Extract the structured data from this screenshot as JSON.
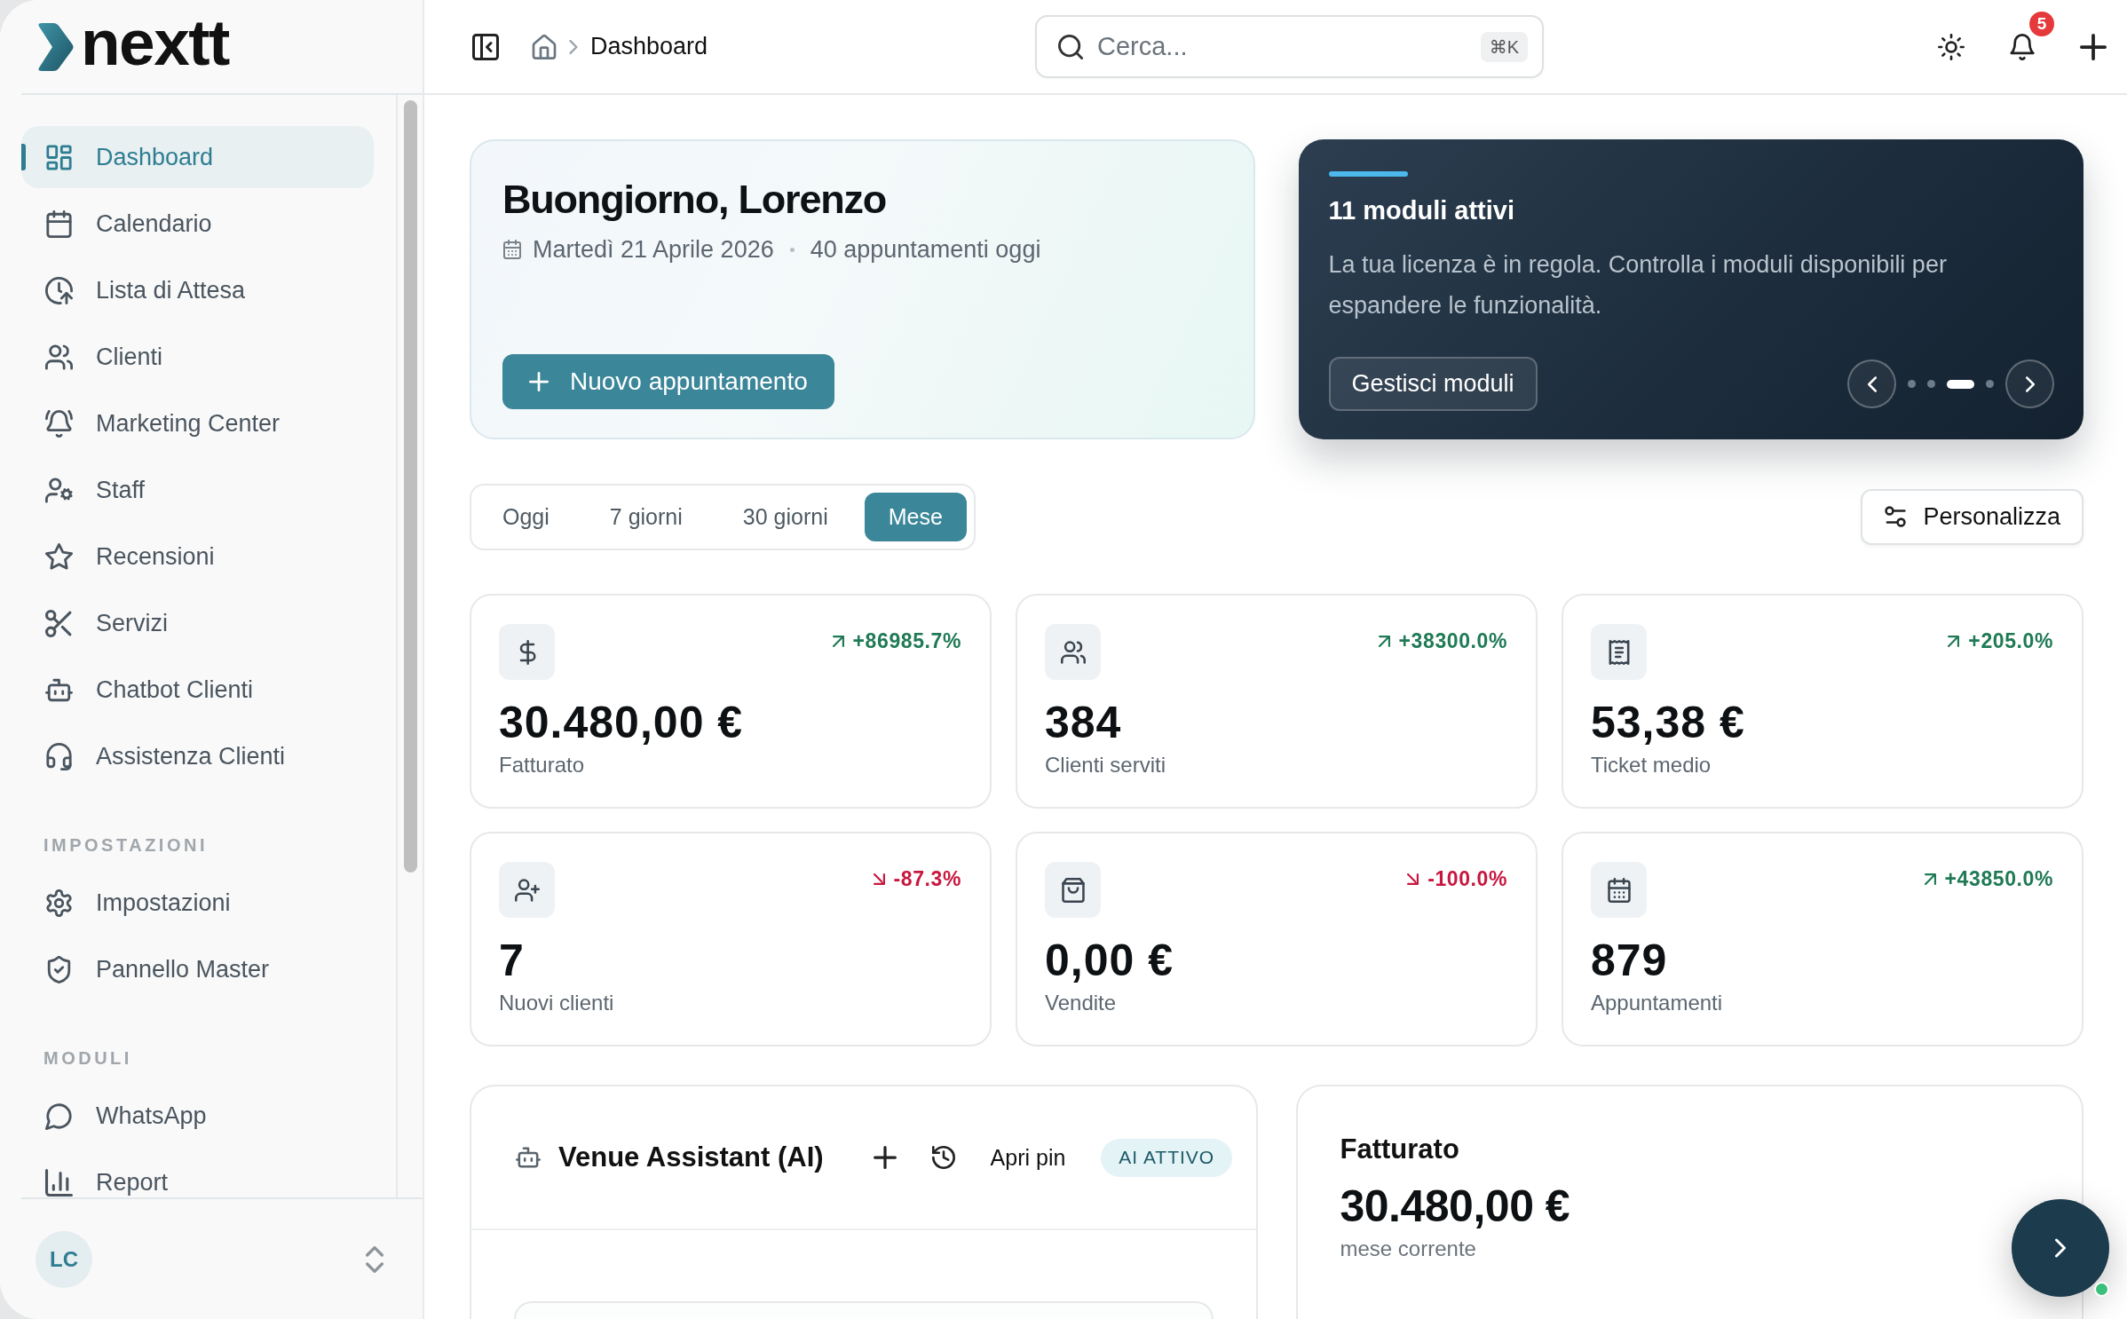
{
  "sidebar": {
    "logo": "nextt",
    "nav": [
      {
        "label": "Dashboard",
        "selected": true
      },
      {
        "label": "Calendario",
        "selected": false
      },
      {
        "label": "Lista di Attesa",
        "selected": false
      },
      {
        "label": "Clienti",
        "selected": false
      },
      {
        "label": "Marketing Center",
        "selected": false
      },
      {
        "label": "Staff",
        "selected": false
      },
      {
        "label": "Recensioni",
        "selected": false
      },
      {
        "label": "Servizi",
        "selected": false
      },
      {
        "label": "Chatbot Clienti",
        "selected": false
      },
      {
        "label": "Assistenza Clienti",
        "selected": false
      }
    ],
    "sections": [
      {
        "heading": "IMPOSTAZIONI",
        "items": [
          {
            "label": "Impostazioni",
            "selected": false
          },
          {
            "label": "Pannello Master",
            "selected": false
          }
        ]
      },
      {
        "heading": "MODULI",
        "items": [
          {
            "label": "WhatsApp",
            "selected": false
          },
          {
            "label": "Report",
            "selected": false
          }
        ]
      }
    ],
    "user": {
      "initials": "LC"
    }
  },
  "header": {
    "breadcrumb": "Dashboard",
    "search": {
      "placeholder": "Cerca...",
      "shortcut": "⌘K"
    },
    "notifications": "5"
  },
  "welcome": {
    "title": "Buongiorno, Lorenzo",
    "date": "Martedì 21 Aprile 2026",
    "appointments": "40 appuntamenti oggi",
    "button": "Nuovo appuntamento"
  },
  "promo": {
    "title": "11 moduli attivi",
    "text": "La tua licenza è in regola. Controlla i moduli disponibili per espandere le funzionalità.",
    "button": "Gestisci moduli",
    "slides": [
      {
        "selected": false
      },
      {
        "selected": false
      },
      {
        "selected": true
      },
      {
        "selected": false
      }
    ]
  },
  "period_tabs": [
    {
      "label": "Oggi",
      "selected": false
    },
    {
      "label": "7 giorni",
      "selected": false
    },
    {
      "label": "30 giorni",
      "selected": false
    },
    {
      "label": "Mese",
      "selected": true
    }
  ],
  "customize_button": "Personalizza",
  "stats": [
    {
      "change": "+86985.7%",
      "kind": "increase",
      "value": "30.480,00 €",
      "label": "Fatturato"
    },
    {
      "change": "+38300.0%",
      "kind": "increase",
      "value": "384",
      "label": "Clienti serviti"
    },
    {
      "change": "+205.0%",
      "kind": "increase",
      "value": "53,38 €",
      "label": "Ticket medio"
    },
    {
      "change": "-87.3%",
      "kind": "decrease",
      "value": "7",
      "label": "Nuovi clienti"
    },
    {
      "change": "-100.0%",
      "kind": "decrease",
      "value": "0,00 €",
      "label": "Vendite"
    },
    {
      "change": "+43850.0%",
      "kind": "increase",
      "value": "879",
      "label": "Appuntamenti"
    }
  ],
  "assistant": {
    "title": "Venue Assistant (AI)",
    "pin_button": "Apri pin",
    "status": "AI ATTIVO"
  },
  "revenue": {
    "title": "Fatturato",
    "value": "30.480,00 €",
    "caption": "mese corrente"
  },
  "fab": {
    "online": true
  }
}
